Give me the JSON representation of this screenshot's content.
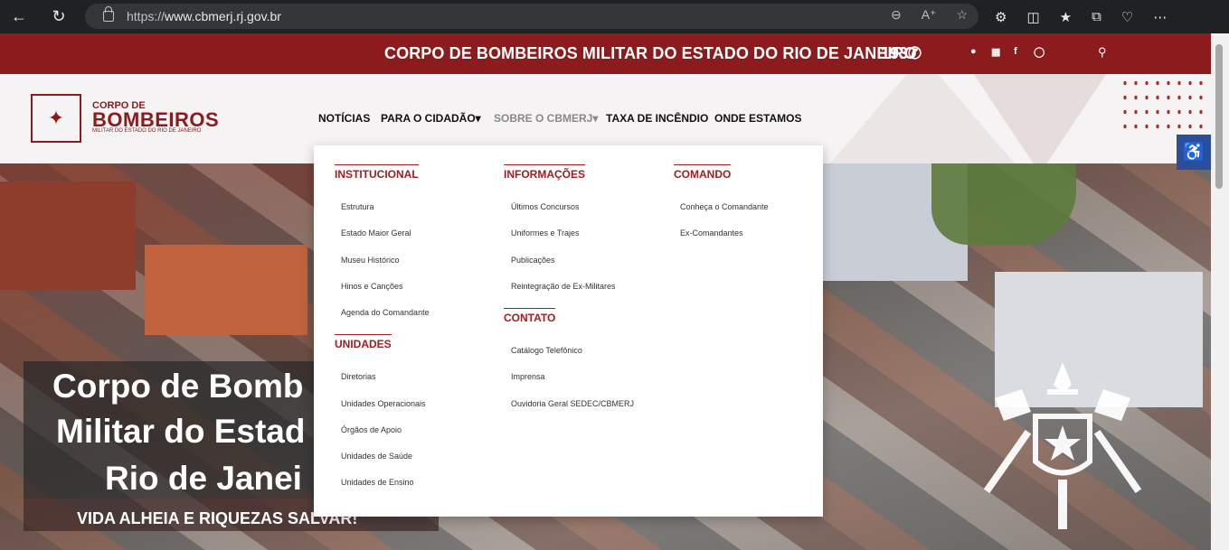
{
  "browser": {
    "url_scheme": "https://",
    "url_host": "www.cbmerj.rj.gov.br"
  },
  "topbar": {
    "title": "CORPO DE BOMBEIROS MILITAR DO ESTADO DO RIO DE JANEIRO",
    "phone": "193"
  },
  "logo": {
    "line1": "CORPO DE",
    "line2": "BOMBEIROS",
    "line3": "MILITAR DO ESTADO DO RIO DE JANEIRO"
  },
  "nav": {
    "noticias": "NOTÍCIAS",
    "cidadao": "PARA O CIDADÃO",
    "sobre": "SOBRE O CBMERJ",
    "taxa": "TAXA DE INCÊNDIO",
    "onde": "ONDE ESTAMOS"
  },
  "dropdown": {
    "institucional": {
      "heading": "INSTITUCIONAL",
      "items": [
        "Estrutura",
        "Estado Maior Geral",
        "Museu Histórico",
        "Hinos e Canções",
        "Agenda do Comandante"
      ]
    },
    "unidades": {
      "heading": "UNIDADES",
      "items": [
        "Diretorias",
        "Unidades Operacionais",
        "Órgãos de Apoio",
        "Unidades de Saúde",
        "Unidades de Ensino"
      ]
    },
    "informacoes": {
      "heading": "INFORMAÇÕES",
      "items": [
        "Últimos Concursos",
        "Uniformes e Trajes",
        "Publicações",
        "Reintegração de Ex-Militares"
      ]
    },
    "contato": {
      "heading": "CONTATO",
      "items": [
        "Catálogo Telefônico",
        "Imprensa",
        "Ouvidoria Geral SEDEC/CBMERJ"
      ]
    },
    "comando": {
      "heading": "COMANDO",
      "items": [
        "Conheça o Comandante",
        "Ex-Comandantes"
      ]
    }
  },
  "hero": {
    "line1": "Corpo de Bomb",
    "line2": "Militar do Estad",
    "line3": "Rio de Janei",
    "subtitle": "VIDA ALHEIA E RIQUEZAS SALVAR!"
  },
  "colors": {
    "brand_red": "#8b1b1c",
    "heading_red": "#a11d21",
    "accessibility_blue": "#2b4e9b"
  }
}
